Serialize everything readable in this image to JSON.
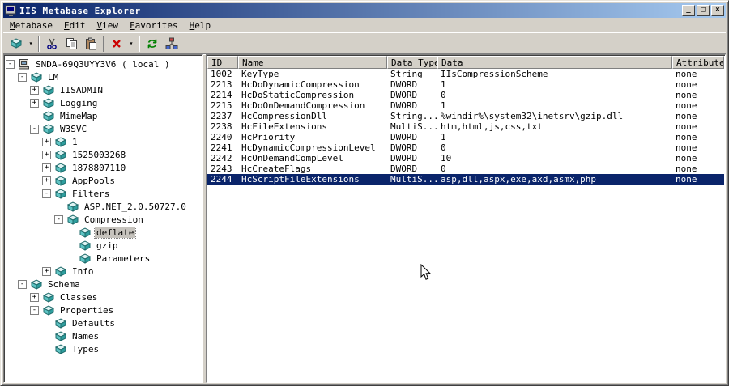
{
  "colors": {
    "titlebar_start": "#0a246a",
    "titlebar_end": "#a6caf0",
    "selection": "#0a246a",
    "chrome": "#d4d0c8",
    "inactive_selection": "#c6c3bd"
  },
  "window": {
    "title": "IIS Metabase Explorer",
    "controls": [
      {
        "name": "minimize",
        "glyph": "_"
      },
      {
        "name": "maximize",
        "glyph": "□"
      },
      {
        "name": "close",
        "glyph": "×"
      }
    ]
  },
  "menu": {
    "items": [
      {
        "label": "Metabase"
      },
      {
        "label": "Edit"
      },
      {
        "label": "View"
      },
      {
        "label": "Favorites"
      },
      {
        "label": "Help"
      }
    ]
  },
  "toolbar": {
    "items": [
      {
        "type": "button",
        "name": "new-key",
        "icon": "key",
        "dropdown": true
      },
      {
        "type": "separator"
      },
      {
        "type": "button",
        "name": "cut",
        "icon": "scissors"
      },
      {
        "type": "button",
        "name": "copy",
        "icon": "copy"
      },
      {
        "type": "button",
        "name": "paste",
        "icon": "clipboard"
      },
      {
        "type": "separator"
      },
      {
        "type": "button",
        "name": "delete",
        "icon": "redx",
        "dropdown": true
      },
      {
        "type": "separator"
      },
      {
        "type": "button",
        "name": "refresh",
        "icon": "refresh"
      },
      {
        "type": "button",
        "name": "connect",
        "icon": "network"
      }
    ]
  },
  "tree": {
    "items": [
      {
        "label": "SNDA-69Q3UYY3V6 ( local )",
        "level": 0,
        "expand": "-",
        "icon": "computer"
      },
      {
        "label": "LM",
        "level": 1,
        "expand": "-",
        "icon": "key"
      },
      {
        "label": "IISADMIN",
        "level": 2,
        "expand": "+",
        "icon": "key"
      },
      {
        "label": "Logging",
        "level": 2,
        "expand": "+",
        "icon": "key"
      },
      {
        "label": "MimeMap",
        "level": 2,
        "expand": null,
        "icon": "key"
      },
      {
        "label": "W3SVC",
        "level": 2,
        "expand": "-",
        "icon": "key"
      },
      {
        "label": "1",
        "level": 3,
        "expand": "+",
        "icon": "key"
      },
      {
        "label": "1525003268",
        "level": 3,
        "expand": "+",
        "icon": "key"
      },
      {
        "label": "1878807110",
        "level": 3,
        "expand": "+",
        "icon": "key"
      },
      {
        "label": "AppPools",
        "level": 3,
        "expand": "+",
        "icon": "key"
      },
      {
        "label": "Filters",
        "level": 3,
        "expand": "-",
        "icon": "key"
      },
      {
        "label": "ASP.NET_2.0.50727.0",
        "level": 4,
        "expand": null,
        "icon": "key"
      },
      {
        "label": "Compression",
        "level": 4,
        "expand": "-",
        "icon": "key"
      },
      {
        "label": "deflate",
        "level": 5,
        "expand": null,
        "icon": "key",
        "selected": true
      },
      {
        "label": "gzip",
        "level": 5,
        "expand": null,
        "icon": "key"
      },
      {
        "label": "Parameters",
        "level": 5,
        "expand": null,
        "icon": "key"
      },
      {
        "label": "Info",
        "level": 3,
        "expand": "+",
        "icon": "key"
      },
      {
        "label": "Schema",
        "level": 1,
        "expand": "-",
        "icon": "key"
      },
      {
        "label": "Classes",
        "level": 2,
        "expand": "+",
        "icon": "key"
      },
      {
        "label": "Properties",
        "level": 2,
        "expand": "-",
        "icon": "key"
      },
      {
        "label": "Defaults",
        "level": 3,
        "expand": null,
        "icon": "key"
      },
      {
        "label": "Names",
        "level": 3,
        "expand": null,
        "icon": "key"
      },
      {
        "label": "Types",
        "level": 3,
        "expand": null,
        "icon": "key"
      }
    ]
  },
  "list": {
    "columns": [
      "ID",
      "Name",
      "Data Type",
      "Data",
      "Attributes"
    ],
    "rows": [
      {
        "id": "1002",
        "name": "KeyType",
        "data_type": "String",
        "data": "IIsCompressionScheme",
        "attributes": "none"
      },
      {
        "id": "2213",
        "name": "HcDoDynamicCompression",
        "data_type": "DWORD",
        "data": "1",
        "attributes": "none"
      },
      {
        "id": "2214",
        "name": "HcDoStaticCompression",
        "data_type": "DWORD",
        "data": "0",
        "attributes": "none"
      },
      {
        "id": "2215",
        "name": "HcDoOnDemandCompression",
        "data_type": "DWORD",
        "data": "1",
        "attributes": "none"
      },
      {
        "id": "2237",
        "name": "HcCompressionDll",
        "data_type": "String...",
        "data": "%windir%\\system32\\inetsrv\\gzip.dll",
        "attributes": "none"
      },
      {
        "id": "2238",
        "name": "HcFileExtensions",
        "data_type": "MultiS...",
        "data": "htm,html,js,css,txt",
        "attributes": "none"
      },
      {
        "id": "2240",
        "name": "HcPriority",
        "data_type": "DWORD",
        "data": "1",
        "attributes": "none"
      },
      {
        "id": "2241",
        "name": "HcDynamicCompressionLevel",
        "data_type": "DWORD",
        "data": "0",
        "attributes": "none"
      },
      {
        "id": "2242",
        "name": "HcOnDemandCompLevel",
        "data_type": "DWORD",
        "data": "10",
        "attributes": "none"
      },
      {
        "id": "2243",
        "name": "HcCreateFlags",
        "data_type": "DWORD",
        "data": "0",
        "attributes": "none"
      },
      {
        "id": "2244",
        "name": "HcScriptFileExtensions",
        "data_type": "MultiS...",
        "data": "asp,dll,aspx,exe,axd,asmx,php",
        "attributes": "none",
        "selected": true
      }
    ]
  }
}
